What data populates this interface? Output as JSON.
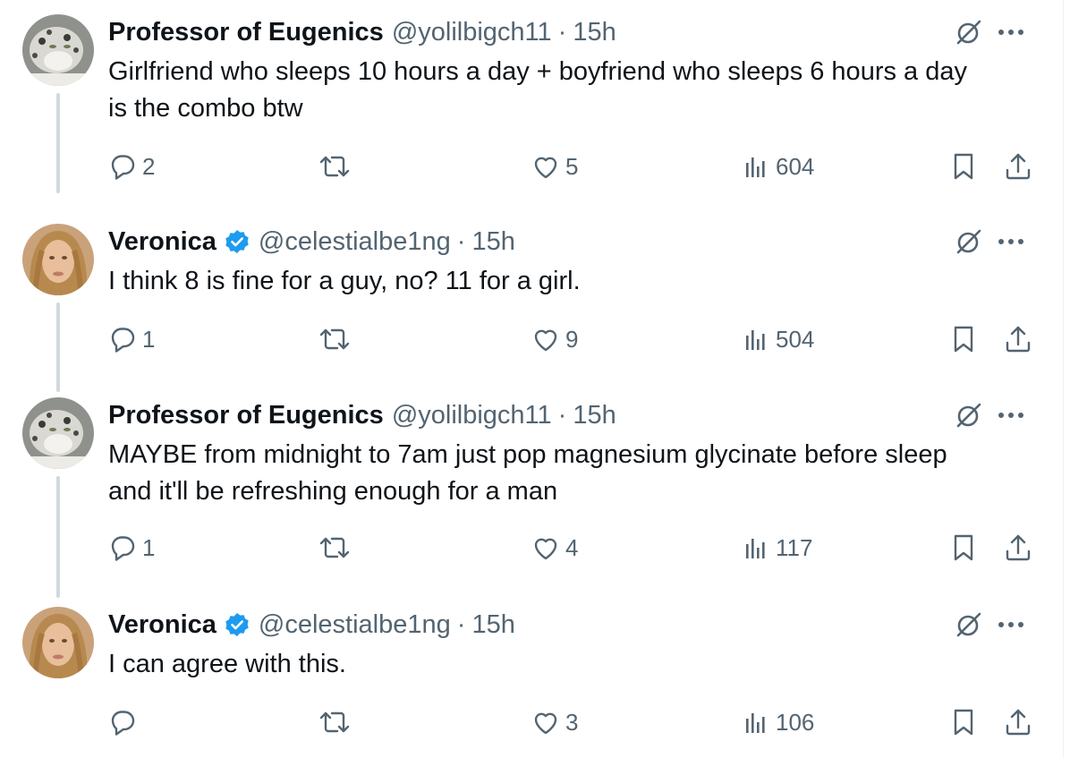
{
  "colors": {
    "text": "#0f1419",
    "secondary": "#536471",
    "thread_line": "#cfd9de",
    "verified": "#1d9bf0"
  },
  "tweets": [
    {
      "name": "Professor of Eugenics",
      "verified": false,
      "handle": "@yolilbigch11",
      "dot": "·",
      "time": "15h",
      "text_lines": [
        "Girlfriend who sleeps 10 hours a day + boyfriend who sleeps 6 hours a day",
        "is the combo btw"
      ],
      "replies": "2",
      "retweets": "",
      "likes": "5",
      "views": "604",
      "avatar": "snow-leopard-avatar"
    },
    {
      "name": "Veronica",
      "verified": true,
      "handle": "@celestialbe1ng",
      "dot": "·",
      "time": "15h",
      "text_lines": [
        "I think 8 is fine for a guy, no? 11 for a girl."
      ],
      "replies": "1",
      "retweets": "",
      "likes": "9",
      "views": "504",
      "avatar": "woman-avatar"
    },
    {
      "name": "Professor of Eugenics",
      "verified": false,
      "handle": "@yolilbigch11",
      "dot": "·",
      "time": "15h",
      "text_lines": [
        "MAYBE from midnight to 7am just pop magnesium glycinate before sleep",
        "and it'll be refreshing enough for a man"
      ],
      "replies": "1",
      "retweets": "",
      "likes": "4",
      "views": "117",
      "avatar": "snow-leopard-avatar"
    },
    {
      "name": "Veronica",
      "verified": true,
      "handle": "@celestialbe1ng",
      "dot": "·",
      "time": "15h",
      "text_lines": [
        "I can agree with this."
      ],
      "replies": "",
      "retweets": "",
      "likes": "3",
      "views": "106",
      "avatar": "woman-avatar"
    }
  ]
}
